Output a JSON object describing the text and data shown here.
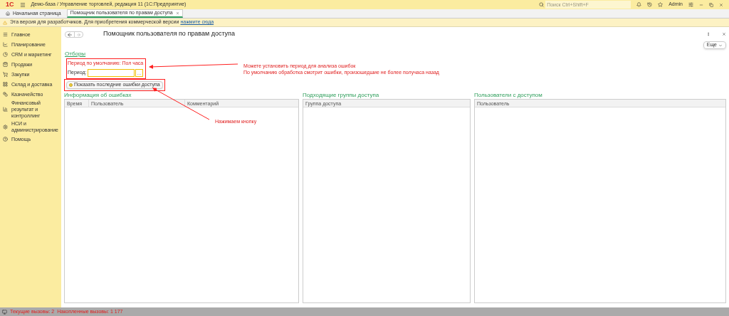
{
  "app_bar": {
    "logo": "1С",
    "title": "Демо-база / Управление торговлей, редакция 11  (1С:Предприятие)",
    "search_placeholder": "Поиск Ctrl+Shift+F",
    "user": "Admin"
  },
  "tabs": [
    {
      "label": "Начальная страница",
      "selected": false,
      "closable": false
    },
    {
      "label": "Помощник пользователя по правам доступа",
      "selected": true,
      "closable": true
    }
  ],
  "warning": {
    "text": "Эта версия для разработчиков. Для приобретения коммерческой версии",
    "link": "нажмите сюда"
  },
  "sidebar": {
    "items": [
      {
        "label": "Главное"
      },
      {
        "label": "Планирование"
      },
      {
        "label": "CRM и маркетинг"
      },
      {
        "label": "Продажи"
      },
      {
        "label": "Закупки"
      },
      {
        "label": "Склад и доставка"
      },
      {
        "label": "Казначейство"
      },
      {
        "label": "Финансовый результат и контроллинг"
      },
      {
        "label": "НСИ и администрирование"
      },
      {
        "label": "Помощь"
      }
    ]
  },
  "form": {
    "title": "Помощник пользователя по правам доступа",
    "more_button": "Еще",
    "filters_link": "Отборы",
    "default_period_note": "Период по умолчанию: Пол часа",
    "period_label": "Период:",
    "period_button": "...",
    "show_button": "Показать последние ошибки доступа"
  },
  "panels": [
    {
      "title": "Информация об ошибках",
      "columns": [
        "Время",
        "Пользователь",
        "Комментарий"
      ]
    },
    {
      "title": "Подходящие группы доступа",
      "columns": [
        "Группа доступа"
      ]
    },
    {
      "title": "Пользователи с доступом",
      "columns": [
        "Пользователь"
      ]
    }
  ],
  "annotations": [
    {
      "lines": [
        "Можете установить период для анализа ошибок",
        "По умолчанию обработка смотрит ошибки, произошедшие не более получаса назад"
      ]
    },
    {
      "lines": [
        "Нажимаем кнопку"
      ]
    }
  ],
  "status_bar": [
    "Текущие вызовы: 2",
    "Накопленные вызовы: 1 177"
  ]
}
